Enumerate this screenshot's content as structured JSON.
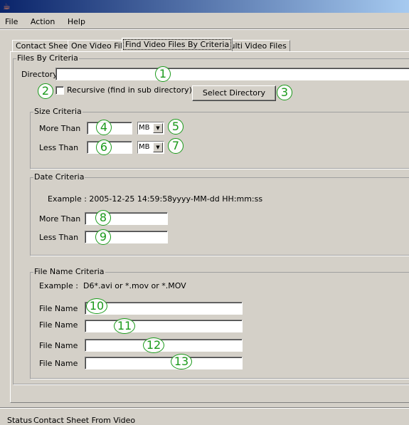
{
  "menu": [
    "File",
    "Action",
    "Help"
  ],
  "tabs": [
    "Contact Sheet",
    "One Video File",
    "Find Video Files By Criteria",
    "Multi Video Files"
  ],
  "files_group": {
    "title": "Files By Criteria",
    "directory_label": "Directory",
    "directory_value": "",
    "recursive_label": "Recursive (find in sub directory)",
    "recursive_checked": false,
    "select_button": "Select Directory"
  },
  "size": {
    "title": "Size Criteria",
    "more_label": "More Than",
    "less_label": "Less Than",
    "more_unit": "MB",
    "less_unit": "MB"
  },
  "date": {
    "title": "Date Criteria",
    "example": "Example : 2005-12-25 14:59:58",
    "format": "yyyy-MM-dd HH:mm:ss",
    "more_label": "More Than",
    "less_label": "Less Than"
  },
  "filename": {
    "title": "File Name Criteria",
    "example_label": "Example :",
    "example": "D6*.avi or *.mov or *.MOV",
    "label": "File Name"
  },
  "status": {
    "label": "Status",
    "text": "Contact Sheet From Video"
  },
  "annotations": [
    "1",
    "2",
    "3",
    "4",
    "5",
    "6",
    "7",
    "8",
    "9",
    "10",
    "11",
    "12",
    "13"
  ],
  "colors": {
    "annotation": "#1a9a1a",
    "titlebar": "#0a246a"
  }
}
